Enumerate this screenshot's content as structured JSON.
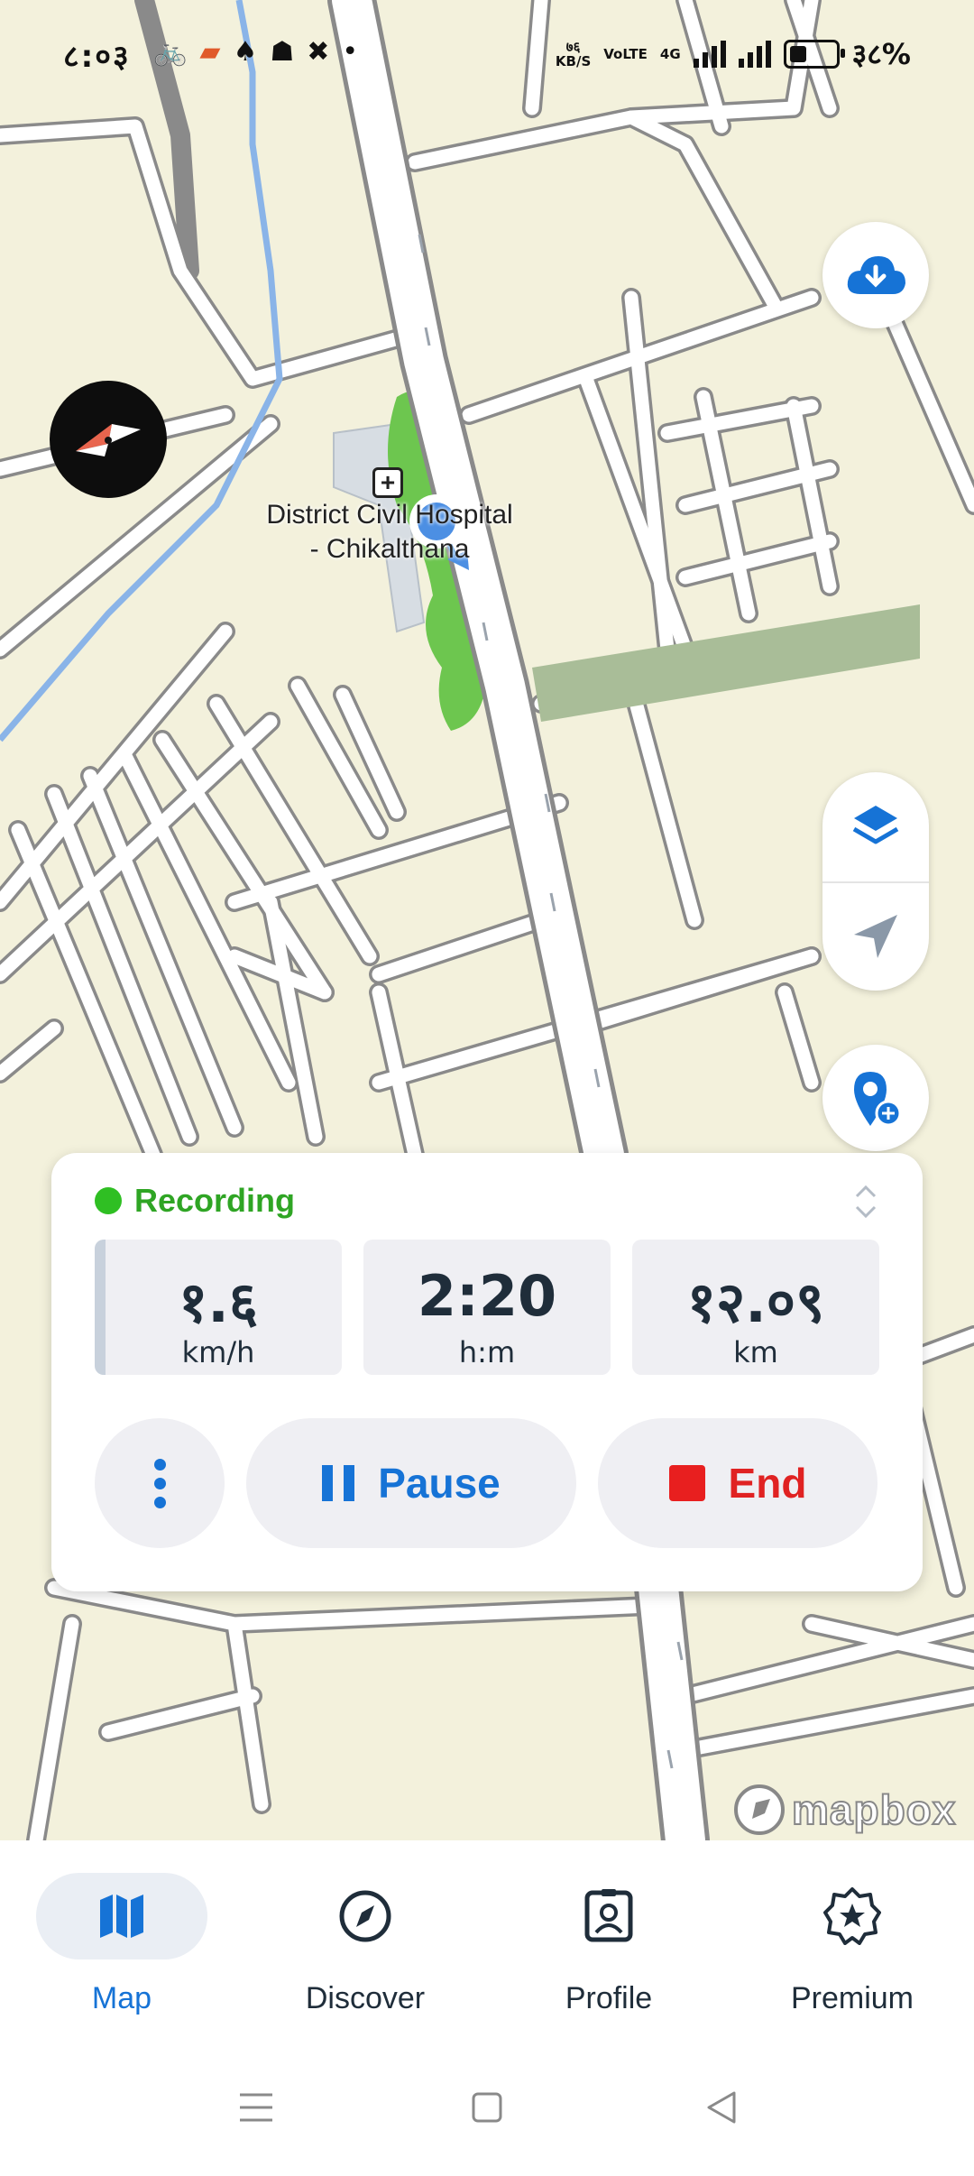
{
  "status_bar": {
    "time": "८:०३",
    "icons": [
      "bike-icon",
      "app-icon",
      "app-icon",
      "app-icon",
      "app-icon",
      "dot-icon"
    ],
    "net_speed_value": "७६",
    "net_speed_unit": "KB/S",
    "volte": "VoLTE",
    "network": "4G",
    "battery_percent": "३८%",
    "battery_level": 0.38
  },
  "map": {
    "place_label_line1": "District Civil Hospital",
    "place_label_line2": "- Chikalthana",
    "attribution": "mapbox",
    "colors": {
      "land": "#f3f1dc",
      "road": "#ffffff",
      "road_casing": "#8a8a8a",
      "water": "#8ab4e8",
      "park": "#6dc64f",
      "track": "#1673d6"
    }
  },
  "controls": {
    "download_icon": "cloud-download-icon",
    "compass_icon": "compass-icon",
    "layers_icon": "layers-icon",
    "locate_icon": "navigation-arrow-icon",
    "add_poi_icon": "add-location-icon"
  },
  "recording": {
    "status": "Recording",
    "stats": [
      {
        "value": "१.६",
        "unit": "km/h"
      },
      {
        "value": "2:20",
        "unit": "h:m"
      },
      {
        "value": "१२.०९",
        "unit": "km"
      }
    ],
    "pause_label": "Pause",
    "end_label": "End"
  },
  "bottom_nav": {
    "items": [
      {
        "label": "Map",
        "icon": "map-icon",
        "active": true
      },
      {
        "label": "Discover",
        "icon": "compass-icon",
        "active": false
      },
      {
        "label": "Profile",
        "icon": "profile-badge-icon",
        "active": false
      },
      {
        "label": "Premium",
        "icon": "star-badge-icon",
        "active": false
      }
    ]
  },
  "accent_colors": {
    "primary": "#1673d6",
    "recording": "#2fbf23",
    "end": "#e02222"
  }
}
